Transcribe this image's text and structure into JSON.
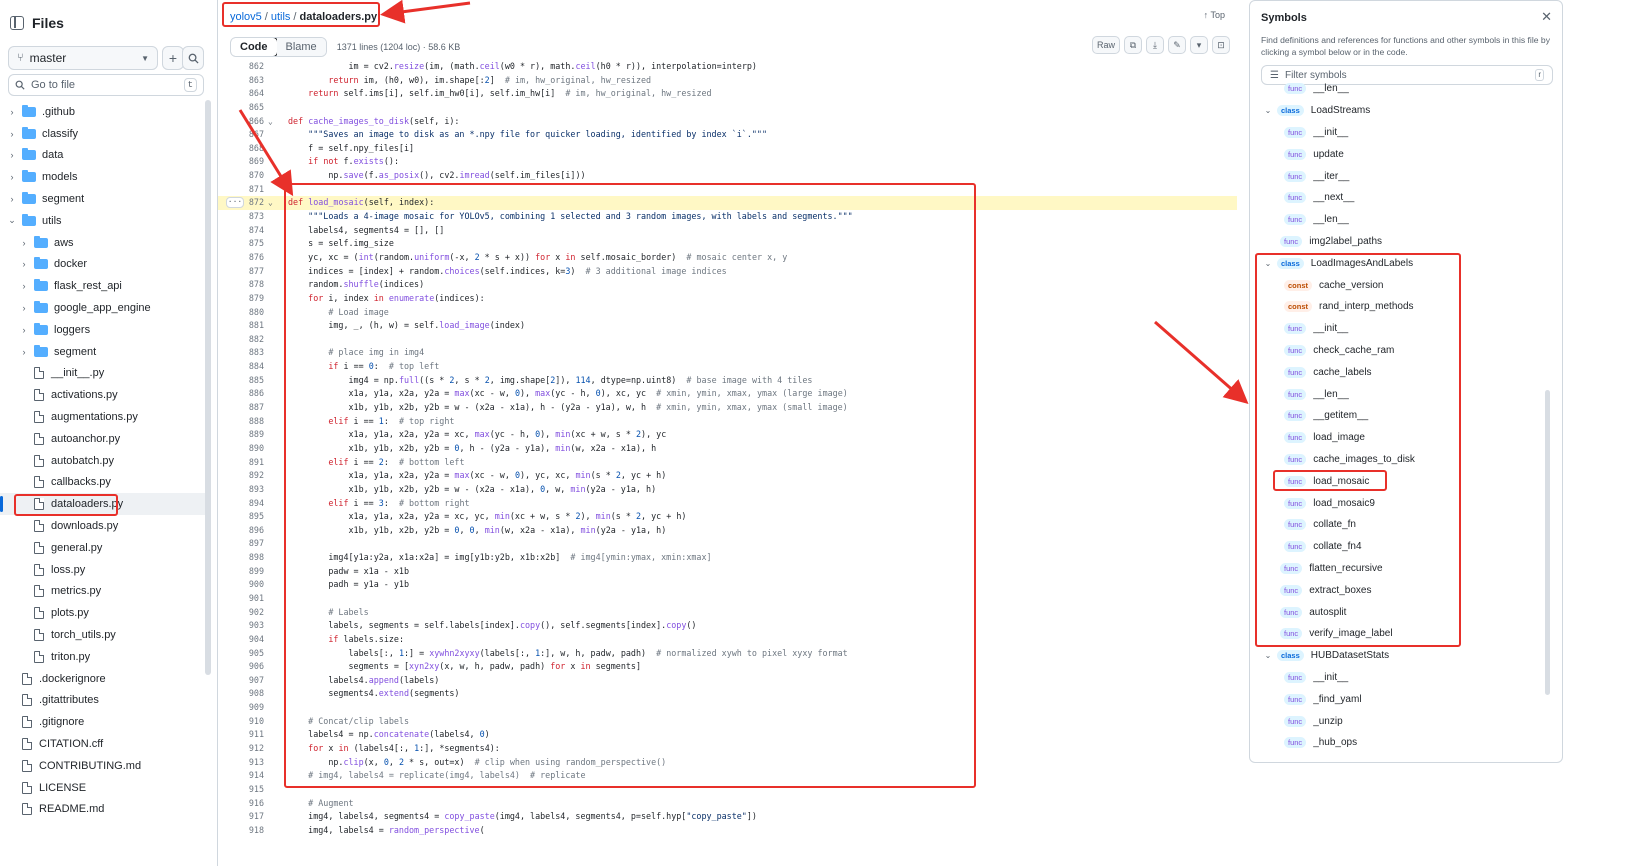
{
  "left_panel": {
    "title": "Files",
    "branch": "master",
    "add_button": "+",
    "goto_placeholder": "Go to file",
    "goto_shortcut": "t",
    "tree": [
      {
        "type": "folder",
        "name": ".github",
        "depth": 0,
        "open": false
      },
      {
        "type": "folder",
        "name": "classify",
        "depth": 0,
        "open": false
      },
      {
        "type": "folder",
        "name": "data",
        "depth": 0,
        "open": false
      },
      {
        "type": "folder",
        "name": "models",
        "depth": 0,
        "open": false
      },
      {
        "type": "folder",
        "name": "segment",
        "depth": 0,
        "open": false
      },
      {
        "type": "folder",
        "name": "utils",
        "depth": 0,
        "open": true
      },
      {
        "type": "folder",
        "name": "aws",
        "depth": 1,
        "open": false
      },
      {
        "type": "folder",
        "name": "docker",
        "depth": 1,
        "open": false
      },
      {
        "type": "folder",
        "name": "flask_rest_api",
        "depth": 1,
        "open": false
      },
      {
        "type": "folder",
        "name": "google_app_engine",
        "depth": 1,
        "open": false
      },
      {
        "type": "folder",
        "name": "loggers",
        "depth": 1,
        "open": false
      },
      {
        "type": "folder",
        "name": "segment",
        "depth": 1,
        "open": false
      },
      {
        "type": "file",
        "name": "__init__.py",
        "depth": 1
      },
      {
        "type": "file",
        "name": "activations.py",
        "depth": 1
      },
      {
        "type": "file",
        "name": "augmentations.py",
        "depth": 1
      },
      {
        "type": "file",
        "name": "autoanchor.py",
        "depth": 1
      },
      {
        "type": "file",
        "name": "autobatch.py",
        "depth": 1
      },
      {
        "type": "file",
        "name": "callbacks.py",
        "depth": 1
      },
      {
        "type": "file",
        "name": "dataloaders.py",
        "depth": 1,
        "selected": true
      },
      {
        "type": "file",
        "name": "downloads.py",
        "depth": 1
      },
      {
        "type": "file",
        "name": "general.py",
        "depth": 1
      },
      {
        "type": "file",
        "name": "loss.py",
        "depth": 1
      },
      {
        "type": "file",
        "name": "metrics.py",
        "depth": 1
      },
      {
        "type": "file",
        "name": "plots.py",
        "depth": 1
      },
      {
        "type": "file",
        "name": "torch_utils.py",
        "depth": 1
      },
      {
        "type": "file",
        "name": "triton.py",
        "depth": 1
      },
      {
        "type": "file",
        "name": ".dockerignore",
        "depth": 0
      },
      {
        "type": "file",
        "name": ".gitattributes",
        "depth": 0
      },
      {
        "type": "file",
        "name": ".gitignore",
        "depth": 0
      },
      {
        "type": "file",
        "name": "CITATION.cff",
        "depth": 0
      },
      {
        "type": "file",
        "name": "CONTRIBUTING.md",
        "depth": 0
      },
      {
        "type": "file",
        "name": "LICENSE",
        "depth": 0
      },
      {
        "type": "file",
        "name": "README.md",
        "depth": 0
      }
    ]
  },
  "breadcrumb": {
    "repo": "yolov5",
    "dir": "utils",
    "file": "dataloaders.py",
    "sep": "/"
  },
  "top_link": "Top",
  "toolbar": {
    "code_tab": "Code",
    "blame_tab": "Blame",
    "meta": "1371 lines (1204 loc) · 58.6 KB",
    "raw": "Raw"
  },
  "code": {
    "highlight_line": 872,
    "lines": [
      {
        "n": 862,
        "t": "            im = cv2.resize(im, (math.ceil(w0 * r), math.ceil(h0 * r)), interpolation=interp)"
      },
      {
        "n": 863,
        "t": "        return im, (h0, w0), im.shape[:2]  # im, hw_original, hw_resized"
      },
      {
        "n": 864,
        "t": "    return self.ims[i], self.im_hw0[i], self.im_hw[i]  # im, hw_original, hw_resized"
      },
      {
        "n": 865,
        "t": ""
      },
      {
        "n": 866,
        "t": "def cache_images_to_disk(self, i):",
        "fold": true
      },
      {
        "n": 867,
        "t": "    \"\"\"Saves an image to disk as an *.npy file for quicker loading, identified by index `i`.\"\"\""
      },
      {
        "n": 868,
        "t": "    f = self.npy_files[i]"
      },
      {
        "n": 869,
        "t": "    if not f.exists():"
      },
      {
        "n": 870,
        "t": "        np.save(f.as_posix(), cv2.imread(self.im_files[i]))"
      },
      {
        "n": 871,
        "t": ""
      },
      {
        "n": 872,
        "t": "def load_mosaic(self, index):",
        "fold": true
      },
      {
        "n": 873,
        "t": "    \"\"\"Loads a 4-image mosaic for YOLOv5, combining 1 selected and 3 random images, with labels and segments.\"\"\""
      },
      {
        "n": 874,
        "t": "    labels4, segments4 = [], []"
      },
      {
        "n": 875,
        "t": "    s = self.img_size"
      },
      {
        "n": 876,
        "t": "    yc, xc = (int(random.uniform(-x, 2 * s + x)) for x in self.mosaic_border)  # mosaic center x, y"
      },
      {
        "n": 877,
        "t": "    indices = [index] + random.choices(self.indices, k=3)  # 3 additional image indices"
      },
      {
        "n": 878,
        "t": "    random.shuffle(indices)"
      },
      {
        "n": 879,
        "t": "    for i, index in enumerate(indices):"
      },
      {
        "n": 880,
        "t": "        # Load image"
      },
      {
        "n": 881,
        "t": "        img, _, (h, w) = self.load_image(index)"
      },
      {
        "n": 882,
        "t": ""
      },
      {
        "n": 883,
        "t": "        # place img in img4"
      },
      {
        "n": 884,
        "t": "        if i == 0:  # top left"
      },
      {
        "n": 885,
        "t": "            img4 = np.full((s * 2, s * 2, img.shape[2]), 114, dtype=np.uint8)  # base image with 4 tiles"
      },
      {
        "n": 886,
        "t": "            x1a, y1a, x2a, y2a = max(xc - w, 0), max(yc - h, 0), xc, yc  # xmin, ymin, xmax, ymax (large image)"
      },
      {
        "n": 887,
        "t": "            x1b, y1b, x2b, y2b = w - (x2a - x1a), h - (y2a - y1a), w, h  # xmin, ymin, xmax, ymax (small image)"
      },
      {
        "n": 888,
        "t": "        elif i == 1:  # top right"
      },
      {
        "n": 889,
        "t": "            x1a, y1a, x2a, y2a = xc, max(yc - h, 0), min(xc + w, s * 2), yc"
      },
      {
        "n": 890,
        "t": "            x1b, y1b, x2b, y2b = 0, h - (y2a - y1a), min(w, x2a - x1a), h"
      },
      {
        "n": 891,
        "t": "        elif i == 2:  # bottom left"
      },
      {
        "n": 892,
        "t": "            x1a, y1a, x2a, y2a = max(xc - w, 0), yc, xc, min(s * 2, yc + h)"
      },
      {
        "n": 893,
        "t": "            x1b, y1b, x2b, y2b = w - (x2a - x1a), 0, w, min(y2a - y1a, h)"
      },
      {
        "n": 894,
        "t": "        elif i == 3:  # bottom right"
      },
      {
        "n": 895,
        "t": "            x1a, y1a, x2a, y2a = xc, yc, min(xc + w, s * 2), min(s * 2, yc + h)"
      },
      {
        "n": 896,
        "t": "            x1b, y1b, x2b, y2b = 0, 0, min(w, x2a - x1a), min(y2a - y1a, h)"
      },
      {
        "n": 897,
        "t": ""
      },
      {
        "n": 898,
        "t": "        img4[y1a:y2a, x1a:x2a] = img[y1b:y2b, x1b:x2b]  # img4[ymin:ymax, xmin:xmax]"
      },
      {
        "n": 899,
        "t": "        padw = x1a - x1b"
      },
      {
        "n": 900,
        "t": "        padh = y1a - y1b"
      },
      {
        "n": 901,
        "t": ""
      },
      {
        "n": 902,
        "t": "        # Labels"
      },
      {
        "n": 903,
        "t": "        labels, segments = self.labels[index].copy(), self.segments[index].copy()"
      },
      {
        "n": 904,
        "t": "        if labels.size:"
      },
      {
        "n": 905,
        "t": "            labels[:, 1:] = xywhn2xyxy(labels[:, 1:], w, h, padw, padh)  # normalized xywh to pixel xyxy format"
      },
      {
        "n": 906,
        "t": "            segments = [xyn2xy(x, w, h, padw, padh) for x in segments]"
      },
      {
        "n": 907,
        "t": "        labels4.append(labels)"
      },
      {
        "n": 908,
        "t": "        segments4.extend(segments)"
      },
      {
        "n": 909,
        "t": ""
      },
      {
        "n": 910,
        "t": "    # Concat/clip labels"
      },
      {
        "n": 911,
        "t": "    labels4 = np.concatenate(labels4, 0)"
      },
      {
        "n": 912,
        "t": "    for x in (labels4[:, 1:], *segments4):"
      },
      {
        "n": 913,
        "t": "        np.clip(x, 0, 2 * s, out=x)  # clip when using random_perspective()"
      },
      {
        "n": 914,
        "t": "    # img4, labels4 = replicate(img4, labels4)  # replicate"
      },
      {
        "n": 915,
        "t": ""
      },
      {
        "n": 916,
        "t": "    # Augment"
      },
      {
        "n": 917,
        "t": "    img4, labels4, segments4 = copy_paste(img4, labels4, segments4, p=self.hyp[\"copy_paste\"])"
      },
      {
        "n": 918,
        "t": "    img4, labels4 = random_perspective("
      }
    ]
  },
  "symbols": {
    "title": "Symbols",
    "close": "✕",
    "description": "Find definitions and references for functions and other symbols in this file by clicking a symbol below or in the code.",
    "filter_placeholder": "Filter symbols",
    "filter_shortcut": "r",
    "items": [
      {
        "kind": "func",
        "name": "__len__",
        "indent": 1
      },
      {
        "kind": "class",
        "name": "LoadStreams",
        "indent": 0,
        "chev": true
      },
      {
        "kind": "func",
        "name": "__init__",
        "indent": 1
      },
      {
        "kind": "func",
        "name": "update",
        "indent": 1
      },
      {
        "kind": "func",
        "name": "__iter__",
        "indent": 1
      },
      {
        "kind": "func",
        "name": "__next__",
        "indent": 1
      },
      {
        "kind": "func",
        "name": "__len__",
        "indent": 1
      },
      {
        "kind": "func",
        "name": "img2label_paths",
        "indent": 0
      },
      {
        "kind": "class",
        "name": "LoadImagesAndLabels",
        "indent": 0,
        "chev": true
      },
      {
        "kind": "const",
        "name": "cache_version",
        "indent": 1
      },
      {
        "kind": "const",
        "name": "rand_interp_methods",
        "indent": 1
      },
      {
        "kind": "func",
        "name": "__init__",
        "indent": 1
      },
      {
        "kind": "func",
        "name": "check_cache_ram",
        "indent": 1
      },
      {
        "kind": "func",
        "name": "cache_labels",
        "indent": 1
      },
      {
        "kind": "func",
        "name": "__len__",
        "indent": 1
      },
      {
        "kind": "func",
        "name": "__getitem__",
        "indent": 1
      },
      {
        "kind": "func",
        "name": "load_image",
        "indent": 1
      },
      {
        "kind": "func",
        "name": "cache_images_to_disk",
        "indent": 1
      },
      {
        "kind": "func",
        "name": "load_mosaic",
        "indent": 1,
        "selected": true
      },
      {
        "kind": "func",
        "name": "load_mosaic9",
        "indent": 1
      },
      {
        "kind": "func",
        "name": "collate_fn",
        "indent": 1
      },
      {
        "kind": "func",
        "name": "collate_fn4",
        "indent": 1
      },
      {
        "kind": "func",
        "name": "flatten_recursive",
        "indent": 0
      },
      {
        "kind": "func",
        "name": "extract_boxes",
        "indent": 0
      },
      {
        "kind": "func",
        "name": "autosplit",
        "indent": 0
      },
      {
        "kind": "func",
        "name": "verify_image_label",
        "indent": 0
      },
      {
        "kind": "class",
        "name": "HUBDatasetStats",
        "indent": 0,
        "chev": true
      },
      {
        "kind": "func",
        "name": "__init__",
        "indent": 1
      },
      {
        "kind": "func",
        "name": "_find_yaml",
        "indent": 1
      },
      {
        "kind": "func",
        "name": "_unzip",
        "indent": 1
      },
      {
        "kind": "func",
        "name": "_hub_ops",
        "indent": 1
      }
    ]
  },
  "colors": {
    "accent": "#0969da",
    "annotation_red": "#e8302a",
    "highlight": "#fff8c5",
    "folder": "#54aeff"
  }
}
